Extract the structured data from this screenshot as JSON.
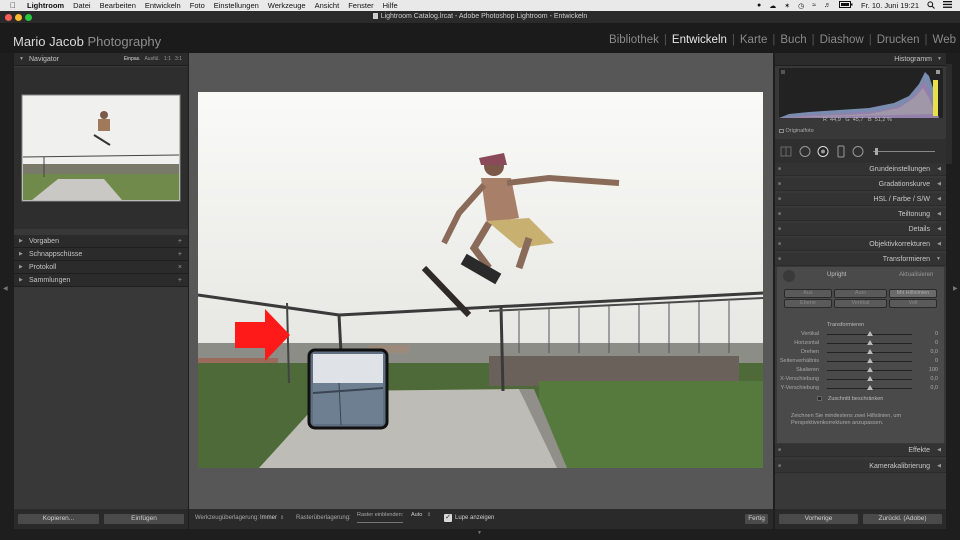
{
  "menubar": {
    "items": [
      "Lightroom",
      "Datei",
      "Bearbeiten",
      "Entwickeln",
      "Foto",
      "Einstellungen",
      "Werkzeuge",
      "Ansicht",
      "Fenster",
      "Hilfe"
    ],
    "clock": "Fr. 10. Juni 19:21"
  },
  "window": {
    "title": "Lightroom Catalog.lrcat - Adobe Photoshop Lightroom - Entwickeln"
  },
  "brand": {
    "name": "Mario Jacob",
    "suffix": "Photography"
  },
  "modules": [
    "Bibliothek",
    "Entwickeln",
    "Karte",
    "Buch",
    "Diashow",
    "Drucken",
    "Web"
  ],
  "left_panel": {
    "navigator": {
      "title": "Navigator",
      "zoom_options": [
        "Einpas.",
        "Ausfül.",
        "1:1",
        "3:1"
      ]
    },
    "sections": [
      {
        "label": "Vorgaben",
        "action": "+"
      },
      {
        "label": "Schnappschüsse",
        "action": "+"
      },
      {
        "label": "Protokoll",
        "action": "×"
      },
      {
        "label": "Sammlungen",
        "action": "+"
      }
    ],
    "copy_label": "Kopieren...",
    "paste_label": "Einfügen"
  },
  "toolbar": {
    "tool_overlay_label": "Werkzeugüberlagerung:",
    "tool_overlay_value": "Immer",
    "grid_overlay_label": "Rasterüberlagerung:",
    "grid_show_label": "Raster einblenden:",
    "grid_show_value": "Auto",
    "loupe_label": "Lupe anzeigen",
    "done_label": "Fertig"
  },
  "right_panel": {
    "histogram": {
      "title": "Histogramm",
      "r_label": "R",
      "r": "44,9",
      "g_label": "G",
      "g": "45,7",
      "b_label": "B",
      "b": "51,2",
      "unit": "%",
      "original_label": "Originalfoto"
    },
    "sections": [
      {
        "label": "Grundeinstellungen"
      },
      {
        "label": "Gradationskurve"
      },
      {
        "label": "HSL / Farbe / S/W"
      },
      {
        "label": "Teiltonung"
      },
      {
        "label": "Details"
      },
      {
        "label": "Objektivkorrekturen"
      },
      {
        "label": "Transformieren"
      }
    ],
    "transform": {
      "upright_label": "Upright",
      "update_label": "Aktualisieren",
      "buttons": [
        "Aus",
        "Auto",
        "Mit Hilfslinien",
        "Ebene",
        "Vertikal",
        "Voll"
      ],
      "sub_title": "Transformieren",
      "sliders": [
        {
          "label": "Vertikal",
          "value": "0",
          "pos": 0.5
        },
        {
          "label": "Horizontal",
          "value": "0",
          "pos": 0.5
        },
        {
          "label": "Drehen",
          "value": "0,0",
          "pos": 0.5
        },
        {
          "label": "Seitenverhältnis",
          "value": "0",
          "pos": 0.5
        },
        {
          "label": "Skalieren",
          "value": "100",
          "pos": 0.5
        },
        {
          "label": "X-Verschiebung",
          "value": "0,0",
          "pos": 0.5
        },
        {
          "label": "Y-Verschiebung",
          "value": "0,0",
          "pos": 0.5
        }
      ],
      "constrain_label": "Zuschnitt beschränken",
      "hint": "Zeichnen Sie mindestens zwei Hilfslinien, um Perspektivenkorrekturen anzupassen."
    },
    "bottom_sections": [
      {
        "label": "Effekte"
      },
      {
        "label": "Kamerakalibrierung"
      }
    ],
    "previous_label": "Vorherige",
    "reset_label": "Zurückl. (Adobe)"
  },
  "colors": {
    "arrow": "#ff1a1a",
    "panel": "#383838",
    "center": "#575757"
  }
}
